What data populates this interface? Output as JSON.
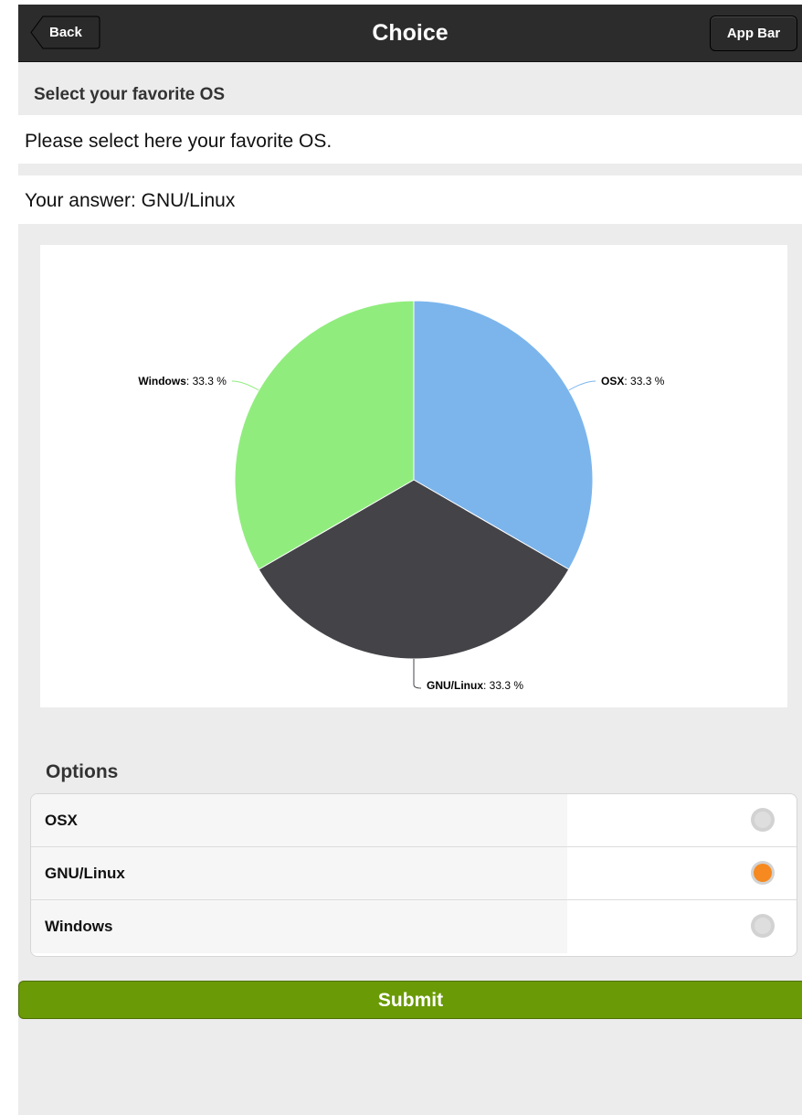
{
  "header": {
    "back_label": "Back",
    "title": "Choice",
    "app_bar_label": "App Bar"
  },
  "question": {
    "title": "Select your favorite OS",
    "description": "Please select here your favorite OS.",
    "answer_text": "Your answer: GNU/Linux"
  },
  "chart_data": {
    "type": "pie",
    "labels": [
      "OSX",
      "GNU/Linux",
      "Windows"
    ],
    "values": [
      33.3,
      33.3,
      33.3
    ],
    "colors": [
      "#7cb5ec",
      "#434348",
      "#90ed7d"
    ],
    "label_values": [
      "33.3 %",
      "33.3 %",
      "33.3 %"
    ],
    "start_angle_deg": 0,
    "direction": "clockwise"
  },
  "options": {
    "title": "Options",
    "items": [
      {
        "label": "OSX",
        "selected": false
      },
      {
        "label": "GNU/Linux",
        "selected": true
      },
      {
        "label": "Windows",
        "selected": false
      }
    ]
  },
  "submit_label": "Submit",
  "colors": {
    "header_bg": "#2c2c2c",
    "accent": "#f6891f",
    "submit_bg": "#6a9a06"
  }
}
